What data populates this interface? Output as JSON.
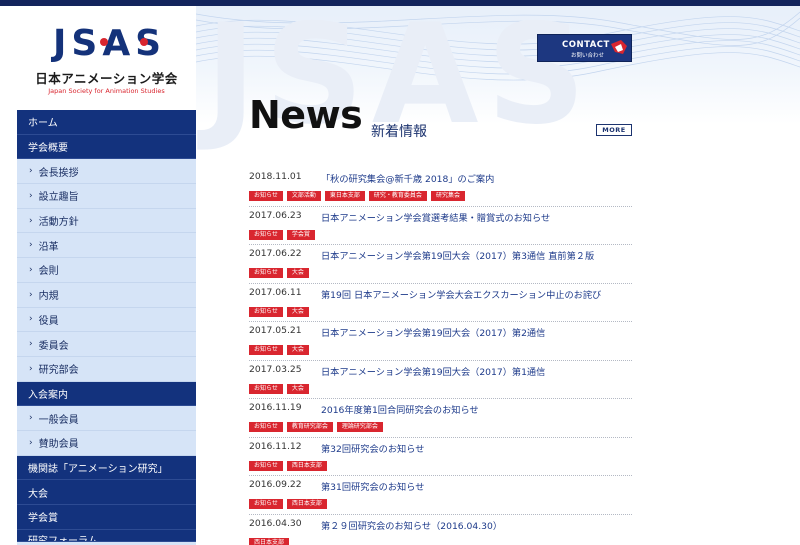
{
  "site": {
    "logo_mark": "JSAS",
    "logo_jp": "日本アニメーション学会",
    "logo_en": "Japan Society for Animation Studies",
    "watermark": "JSAS"
  },
  "contact": {
    "label": "CONTACT",
    "sub": "お問い合わせ"
  },
  "sidebar": {
    "items": [
      {
        "label": "ホーム",
        "type": "top"
      },
      {
        "label": "学会概要",
        "type": "top"
      },
      {
        "label": "会長挨拶",
        "type": "sub"
      },
      {
        "label": "設立趣旨",
        "type": "sub"
      },
      {
        "label": "活動方針",
        "type": "sub"
      },
      {
        "label": "沿革",
        "type": "sub"
      },
      {
        "label": "会則",
        "type": "sub"
      },
      {
        "label": "内規",
        "type": "sub"
      },
      {
        "label": "役員",
        "type": "sub"
      },
      {
        "label": "委員会",
        "type": "sub"
      },
      {
        "label": "研究部会",
        "type": "sub"
      },
      {
        "label": "入会案内",
        "type": "top"
      },
      {
        "label": "一般会員",
        "type": "sub"
      },
      {
        "label": "賛助会員",
        "type": "sub"
      },
      {
        "label": "機関誌「アニメーション研究」",
        "type": "top"
      },
      {
        "label": "大会",
        "type": "top"
      },
      {
        "label": "学会賞",
        "type": "top"
      },
      {
        "label": "研究フォーラム",
        "type": "top"
      }
    ]
  },
  "news": {
    "title": "News",
    "subtitle": "新着情報",
    "more": "MORE",
    "items": [
      {
        "date": "2018.11.01",
        "title": "「秋の研究集会@新千歳 2018」のご案内",
        "tags": [
          "お知らせ",
          "文部活動",
          "東日本支部",
          "研究・教育委員会",
          "研究集会"
        ]
      },
      {
        "date": "2017.06.23",
        "title": "日本アニメーション学会賞選考結果・贈賞式のお知らせ",
        "tags": [
          "お知らせ",
          "学会賞"
        ]
      },
      {
        "date": "2017.06.22",
        "title": "日本アニメーション学会第19回大会（2017）第3通信 直前第２版",
        "tags": [
          "お知らせ",
          "大会"
        ]
      },
      {
        "date": "2017.06.11",
        "title": "第19回 日本アニメーション学会大会エクスカーション中止のお詫び",
        "tags": [
          "お知らせ",
          "大会"
        ]
      },
      {
        "date": "2017.05.21",
        "title": "日本アニメーション学会第19回大会（2017）第2通信",
        "tags": [
          "お知らせ",
          "大会"
        ]
      },
      {
        "date": "2017.03.25",
        "title": "日本アニメーション学会第19回大会（2017）第1通信",
        "tags": [
          "お知らせ",
          "大会"
        ]
      },
      {
        "date": "2016.11.19",
        "title": "2016年度第1回合同研究会のお知らせ",
        "tags": [
          "お知らせ",
          "教育研究部会",
          "理論研究部会"
        ]
      },
      {
        "date": "2016.11.12",
        "title": "第32回研究会のお知らせ",
        "tags": [
          "お知らせ",
          "西日本支部"
        ]
      },
      {
        "date": "2016.09.22",
        "title": "第31回研究会のお知らせ",
        "tags": [
          "お知らせ",
          "西日本支部"
        ]
      },
      {
        "date": "2016.04.30",
        "title": "第２９回研究会のお知らせ（2016.04.30）",
        "tags": [
          "西日本支部"
        ]
      }
    ]
  },
  "colors": {
    "navy": "#13327d",
    "accent_red": "#d9262f",
    "sidebar_bg": "#d6e4f7",
    "link": "#1d3a8a"
  }
}
